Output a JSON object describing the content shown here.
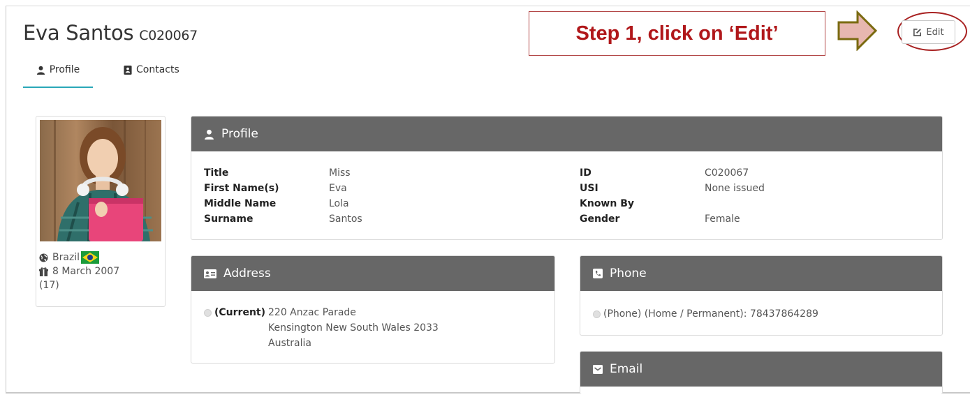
{
  "student": {
    "name": "Eva Santos",
    "code": "C020067"
  },
  "tabs": [
    {
      "label": "Profile",
      "icon": "user-icon"
    },
    {
      "label": "Contacts",
      "icon": "address-book-icon"
    }
  ],
  "callout": {
    "text": "Step 1, click on ‘Edit’",
    "border_color": "#b34848",
    "text_color": "#b0171a",
    "arrow_color": "#e7b7b0"
  },
  "toolbar": {
    "edit_label": "Edit"
  },
  "sidebar": {
    "country": "Brazil",
    "birthdate": "8 March 2007",
    "age": "(17)"
  },
  "profile_panel": {
    "title": "Profile",
    "left_fields": [
      {
        "label": "Title",
        "value": "Miss"
      },
      {
        "label": "First Name(s)",
        "value": "Eva"
      },
      {
        "label": "Middle Name",
        "value": "Lola"
      },
      {
        "label": "Surname",
        "value": "Santos"
      }
    ],
    "right_fields": [
      {
        "label": "ID",
        "value": "C020067"
      },
      {
        "label": "USI",
        "value": "None issued"
      },
      {
        "label": "Known By",
        "value": ""
      },
      {
        "label": "Gender",
        "value": "Female"
      }
    ]
  },
  "address_panel": {
    "title": "Address",
    "tag": "(Current)",
    "lines": [
      "220 Anzac Parade",
      "Kensington New South Wales 2033",
      "Australia"
    ]
  },
  "phone_panel": {
    "title": "Phone",
    "entry": "(Phone) (Home / Permanent): 78437864289"
  },
  "email_panel": {
    "title": "Email"
  },
  "colors": {
    "panel_header": "#676767",
    "tab_underline": "#2aa8b8",
    "edit_ring": "#a82121"
  }
}
